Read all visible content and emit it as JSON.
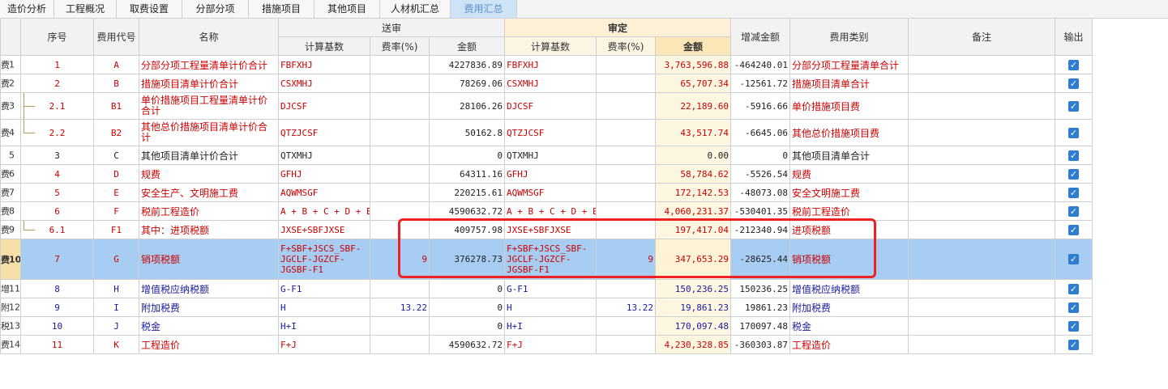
{
  "tabs": [
    {
      "label": "造价分析",
      "active": false
    },
    {
      "label": "工程概况",
      "active": false
    },
    {
      "label": "取费设置",
      "active": false
    },
    {
      "label": "分部分项",
      "active": false
    },
    {
      "label": "措施项目",
      "active": false
    },
    {
      "label": "其他项目",
      "active": false
    },
    {
      "label": "人材机汇总",
      "active": false
    },
    {
      "label": "费用汇总",
      "active": true
    }
  ],
  "headers": {
    "seq": "序号",
    "code": "费用代号",
    "name": "名称",
    "submitted_group": "送审",
    "audit_group": "审定",
    "base": "计算基数",
    "rate": "费率(%)",
    "amount": "金额",
    "audit_amount": "金额",
    "diff": "增减金额",
    "category": "费用类别",
    "remark": "备注",
    "output": "输出"
  },
  "rows": [
    {
      "prefix": "费",
      "num": "1",
      "expander": "",
      "tree": "",
      "seq": "1",
      "code": "A",
      "name": "分部分项工程量清单计价合计",
      "s_base": "FBFXHJ",
      "s_rate": "",
      "s_amount": "4227836.89",
      "a_base": "FBFXHJ",
      "a_rate": "",
      "a_amount": "3,763,596.88",
      "diff": "-464240.01",
      "category": "分部分项工程量清单合计",
      "remark": "",
      "output": true,
      "color": "red"
    },
    {
      "prefix": "费",
      "num": "2",
      "expander": "−",
      "tree": "",
      "seq": "2",
      "code": "B",
      "name": "措施项目清单计价合计",
      "s_base": "CSXMHJ",
      "s_rate": "",
      "s_amount": "78269.06",
      "a_base": "CSXMHJ",
      "a_rate": "",
      "a_amount": "65,707.34",
      "diff": "-12561.72",
      "category": "措施项目清单合计",
      "remark": "",
      "output": true,
      "color": "red"
    },
    {
      "prefix": "费",
      "num": "3",
      "expander": "",
      "tree": "mid",
      "seq": "2.1",
      "code": "B1",
      "name": "单价措施项目工程量清单计价合计",
      "s_base": "DJCSF",
      "s_rate": "",
      "s_amount": "28106.26",
      "a_base": "DJCSF",
      "a_rate": "",
      "a_amount": "22,189.60",
      "diff": "-5916.66",
      "category": "单价措施项目费",
      "remark": "",
      "output": true,
      "color": "red"
    },
    {
      "prefix": "费",
      "num": "4",
      "expander": "",
      "tree": "last",
      "seq": "2.2",
      "code": "B2",
      "name": "其他总价措施项目清单计价合计",
      "s_base": "QTZJCSF",
      "s_rate": "",
      "s_amount": "50162.8",
      "a_base": "QTZJCSF",
      "a_rate": "",
      "a_amount": "43,517.74",
      "diff": "-6645.06",
      "category": "其他总价措施项目费",
      "remark": "",
      "output": true,
      "color": "red"
    },
    {
      "prefix": "",
      "num": "5",
      "expander": "",
      "tree": "",
      "seq": "3",
      "code": "C",
      "name": "其他项目清单计价合计",
      "s_base": "QTXMHJ",
      "s_rate": "",
      "s_amount": "0",
      "a_base": "QTXMHJ",
      "a_rate": "",
      "a_amount": "0.00",
      "diff": "0",
      "category": "其他项目清单合计",
      "remark": "",
      "output": true,
      "color": "blk"
    },
    {
      "prefix": "费",
      "num": "6",
      "expander": "",
      "tree": "",
      "seq": "4",
      "code": "D",
      "name": "规费",
      "s_base": "GFHJ",
      "s_rate": "",
      "s_amount": "64311.16",
      "a_base": "GFHJ",
      "a_rate": "",
      "a_amount": "58,784.62",
      "diff": "-5526.54",
      "category": "规费",
      "remark": "",
      "output": true,
      "color": "red"
    },
    {
      "prefix": "费",
      "num": "7",
      "expander": "",
      "tree": "",
      "seq": "5",
      "code": "E",
      "name": "安全生产、文明施工费",
      "s_base": "AQWMSGF",
      "s_rate": "",
      "s_amount": "220215.61",
      "a_base": "AQWMSGF",
      "a_rate": "",
      "a_amount": "172,142.53",
      "diff": "-48073.08",
      "category": "安全文明施工费",
      "remark": "",
      "output": true,
      "color": "red"
    },
    {
      "prefix": "费",
      "num": "8",
      "expander": "−",
      "tree": "",
      "seq": "6",
      "code": "F",
      "name": "税前工程造价",
      "s_base": "A + B + C + D + E",
      "s_rate": "",
      "s_amount": "4590632.72",
      "a_base": "A + B + C + D + E",
      "a_rate": "",
      "a_amount": "4,060,231.37",
      "diff": "-530401.35",
      "category": "税前工程造价",
      "remark": "",
      "output": true,
      "color": "red"
    },
    {
      "prefix": "费",
      "num": "9",
      "expander": "",
      "tree": "last",
      "seq": "6.1",
      "code": "F1",
      "name": "其中：进项税额",
      "s_base": "JXSE+SBFJXSE",
      "s_rate": "",
      "s_amount": "409757.98",
      "a_base": "JXSE+SBFJXSE",
      "a_rate": "",
      "a_amount": "197,417.04",
      "diff": "-212340.94",
      "category": "进项税额",
      "remark": "",
      "output": true,
      "color": "red"
    },
    {
      "prefix": "费",
      "num": "10",
      "expander": "",
      "tree": "",
      "seq": "7",
      "code": "G",
      "name": "销项税额",
      "s_base": "F+SBF+JSCS_SBF-JGCLF-JGZCF-JGSBF-F1",
      "s_rate": "9",
      "s_amount": "376278.73",
      "a_base": "F+SBF+JSCS_SBF-JGCLF-JGZCF-JGSBF-F1",
      "a_rate": "9",
      "a_amount": "347,653.29",
      "diff": "-28625.44",
      "category": "销项税额",
      "remark": "",
      "output": true,
      "color": "red",
      "selected": true
    },
    {
      "prefix": "增",
      "num": "11",
      "expander": "",
      "tree": "",
      "seq": "8",
      "code": "H",
      "name": "增值税应纳税额",
      "s_base": "G-F1",
      "s_rate": "",
      "s_amount": "0",
      "a_base": "G-F1",
      "a_rate": "",
      "a_amount": "150,236.25",
      "diff": "150236.25",
      "category": "增值税应纳税额",
      "remark": "",
      "output": true,
      "color": "blue"
    },
    {
      "prefix": "附",
      "num": "12",
      "expander": "",
      "tree": "",
      "seq": "9",
      "code": "I",
      "name": "附加税费",
      "s_base": "H",
      "s_rate": "13.22",
      "s_amount": "0",
      "a_base": "H",
      "a_rate": "13.22",
      "a_amount": "19,861.23",
      "diff": "19861.23",
      "category": "附加税费",
      "remark": "",
      "output": true,
      "color": "blue"
    },
    {
      "prefix": "税",
      "num": "13",
      "expander": "",
      "tree": "",
      "seq": "10",
      "code": "J",
      "name": "税金",
      "s_base": "H+I",
      "s_rate": "",
      "s_amount": "0",
      "a_base": "H+I",
      "a_rate": "",
      "a_amount": "170,097.48",
      "diff": "170097.48",
      "category": "税金",
      "remark": "",
      "output": true,
      "color": "blue"
    },
    {
      "prefix": "费",
      "num": "14",
      "expander": "",
      "tree": "",
      "seq": "11",
      "code": "K",
      "name": "工程造价",
      "s_base": "F+J",
      "s_rate": "",
      "s_amount": "4590632.72",
      "a_base": "F+J",
      "a_rate": "",
      "a_amount": "4,230,328.85",
      "diff": "-360303.87",
      "category": "工程造价",
      "remark": "",
      "output": true,
      "color": "red"
    }
  ],
  "colors": {
    "active_tab_bg": "#cfe3f7",
    "selected_row_bg": "#a8cdf2",
    "audit_header_bg": "#fdf0d6",
    "red_text": "#cc0000",
    "blue_text": "#1a1a9e",
    "highlight_border": "#ee2222",
    "checkbox_blue": "#2f7dd1"
  }
}
